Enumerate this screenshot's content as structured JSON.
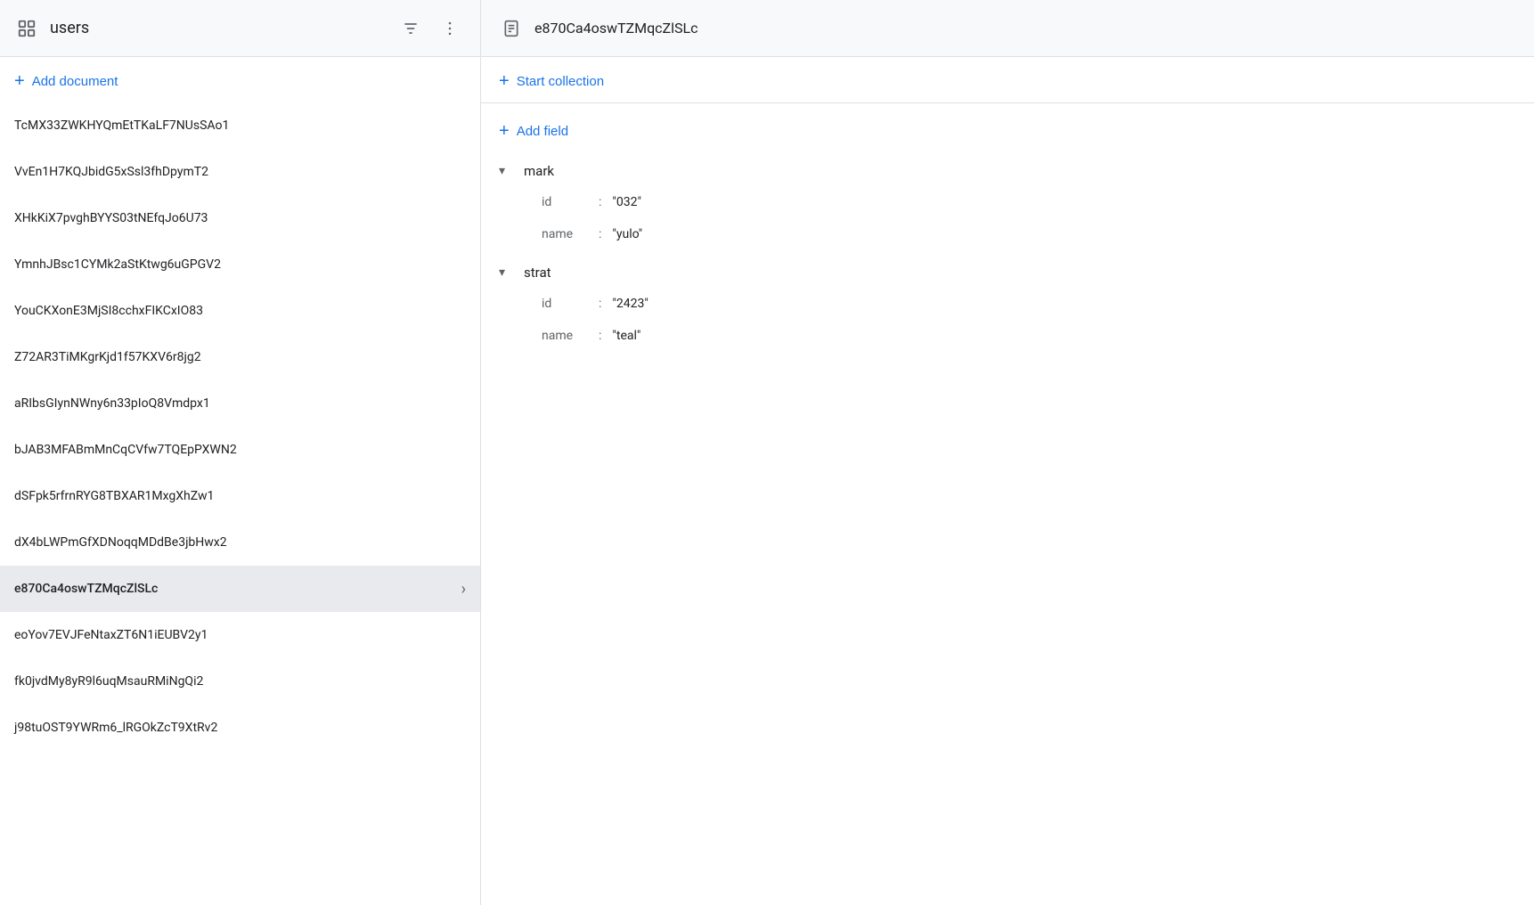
{
  "header": {
    "collection_icon": "≡",
    "title": "users",
    "filter_icon": "≡",
    "more_icon": "⋮",
    "doc_icon": "☰",
    "doc_title": "e870Ca4oswTZMqcZlSLc"
  },
  "left_panel": {
    "add_document_label": "Add document",
    "documents": [
      {
        "id": "doc-1",
        "text": "TcMX33ZWKHYQmEtTKaLF7NUsSAo1",
        "selected": false
      },
      {
        "id": "doc-2",
        "text": "VvEn1H7KQJbidG5xSsl3fhDpymT2",
        "selected": false
      },
      {
        "id": "doc-3",
        "text": "XHkKiX7pvghBYYS03tNEfqJo6U73",
        "selected": false
      },
      {
        "id": "doc-4",
        "text": "YmnhJBsc1CYMk2aStKtwg6uGPGV2",
        "selected": false
      },
      {
        "id": "doc-5",
        "text": "YouCKXonE3MjSI8cchxFIKCxIO83",
        "selected": false
      },
      {
        "id": "doc-6",
        "text": "Z72AR3TiMKgrKjd1f57KXV6r8jg2",
        "selected": false
      },
      {
        "id": "doc-7",
        "text": "aRIbsGIynNWny6n33pIoQ8Vmdpx1",
        "selected": false
      },
      {
        "id": "doc-8",
        "text": "bJAB3MFABmMnCqCVfw7TQEpPXWN2",
        "selected": false
      },
      {
        "id": "doc-9",
        "text": "dSFpk5rfrnRYG8TBXAR1MxgXhZw1",
        "selected": false
      },
      {
        "id": "doc-10",
        "text": "dX4bLWPmGfXDNoqqMDdBe3jbHwx2",
        "selected": false
      },
      {
        "id": "doc-11",
        "text": "e870Ca4oswTZMqcZlSLc",
        "selected": true
      },
      {
        "id": "doc-12",
        "text": "eoYov7EVJFeNtaxZT6N1iEUBV2y1",
        "selected": false
      },
      {
        "id": "doc-13",
        "text": "fk0jvdMy8yR9l6uqMsauRMiNgQi2",
        "selected": false
      },
      {
        "id": "doc-14",
        "text": "j98tuOST9YWRm6_lRGOkZcT9XtRv2",
        "selected": false
      }
    ]
  },
  "right_panel": {
    "start_collection_label": "Start collection",
    "add_field_label": "Add field",
    "fields": [
      {
        "id": "field-mark",
        "name": "mark",
        "expanded": true,
        "entries": [
          {
            "key": "id",
            "value": "\"032\""
          },
          {
            "key": "name",
            "value": "\"yulo\""
          }
        ]
      },
      {
        "id": "field-strat",
        "name": "strat",
        "expanded": true,
        "entries": [
          {
            "key": "id",
            "value": "\"2423\""
          },
          {
            "key": "name",
            "value": "\"teal\""
          }
        ]
      }
    ]
  },
  "icons": {
    "plus": "+",
    "chevron_down": "▾",
    "chevron_right": "›",
    "filter": "⊟",
    "more_vert": "⋮",
    "collection": "☰",
    "document": "☰"
  }
}
